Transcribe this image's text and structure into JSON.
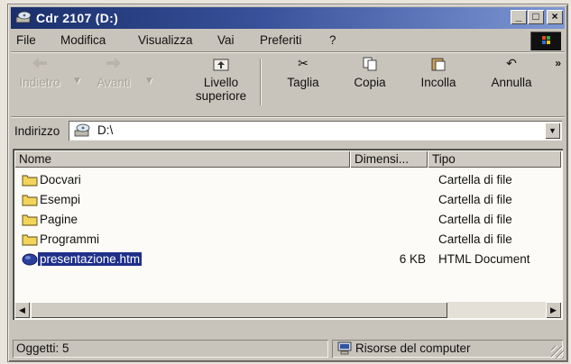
{
  "window": {
    "title": "Cdr 2107 (D:)",
    "controls": {
      "minimize": "_",
      "maximize": "□",
      "close": "×"
    }
  },
  "menu": [
    "File",
    "Modifica",
    "Visualizza",
    "Vai",
    "Preferiti",
    "?"
  ],
  "toolbar": {
    "back": "Indietro",
    "forward": "Avanti",
    "up_line1": "Livello",
    "up_line2": "superiore",
    "cut": "Taglia",
    "copy": "Copia",
    "paste": "Incolla",
    "undo": "Annulla",
    "more": "»"
  },
  "address": {
    "label": "Indirizzo",
    "value": "D:\\"
  },
  "columns": {
    "name": "Nome",
    "size": "Dimensi...",
    "type": "Tipo"
  },
  "files": [
    {
      "name": "Docvari",
      "size": "",
      "type": "Cartella di file",
      "icon": "folder-icon"
    },
    {
      "name": "Esempi",
      "size": "",
      "type": "Cartella di file",
      "icon": "folder-icon"
    },
    {
      "name": "Pagine",
      "size": "",
      "type": "Cartella di file",
      "icon": "folder-icon"
    },
    {
      "name": "Programmi",
      "size": "",
      "type": "Cartella di file",
      "icon": "folder-icon"
    },
    {
      "name": "presentazione.htm",
      "size": "6 KB",
      "type": "HTML Document",
      "icon": "html-document-icon",
      "selected": true
    }
  ],
  "status": {
    "objects": "Oggetti: 5",
    "location": "Risorse del computer"
  },
  "colors": {
    "title_start": "#1a2f6b",
    "title_end": "#7d97d4",
    "selection": "#1e2f8a",
    "folder": "#f2d45a"
  }
}
